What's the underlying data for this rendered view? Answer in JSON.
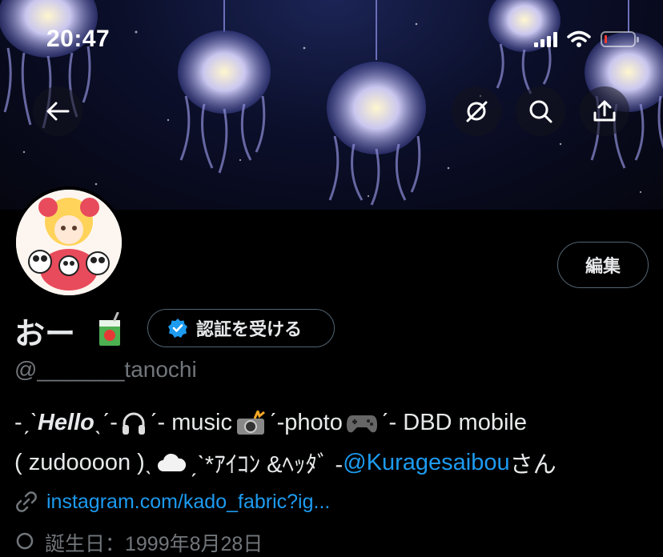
{
  "status_bar": {
    "time": "20:47"
  },
  "header": {
    "banner_alt": "jellyfish lanterns"
  },
  "nav": {
    "back_icon": "back-arrow-icon",
    "icons": [
      "grok-icon",
      "search-icon",
      "share-icon"
    ]
  },
  "profile": {
    "edit_label": "編集",
    "display_name": "おー",
    "verify_label": "認証を受ける",
    "handle": "@_______tanochi",
    "bio": {
      "line1": {
        "part1": "-ˏˋ ",
        "hello": "Hello",
        "part2": "ˎˊ-",
        "part3": " ˊ- music ",
        "part4": " ˊ-photo ",
        "part5": " ˊ- DBD mobile"
      },
      "line2": {
        "part1": "( zudoooon )ˎ",
        "part2": "ˏˋ*ｱｲｺﾝ &ﾍｯﾀﾞ -",
        "mention": "@Kuragesaibou",
        "part3": " さん"
      }
    },
    "link": "instagram.com/kado_fabric?ig...",
    "birth_partial": "誕生日：1999年8月28日"
  },
  "colors": {
    "accent": "#1d9bf0",
    "muted": "#71767b",
    "border": "#536471"
  }
}
